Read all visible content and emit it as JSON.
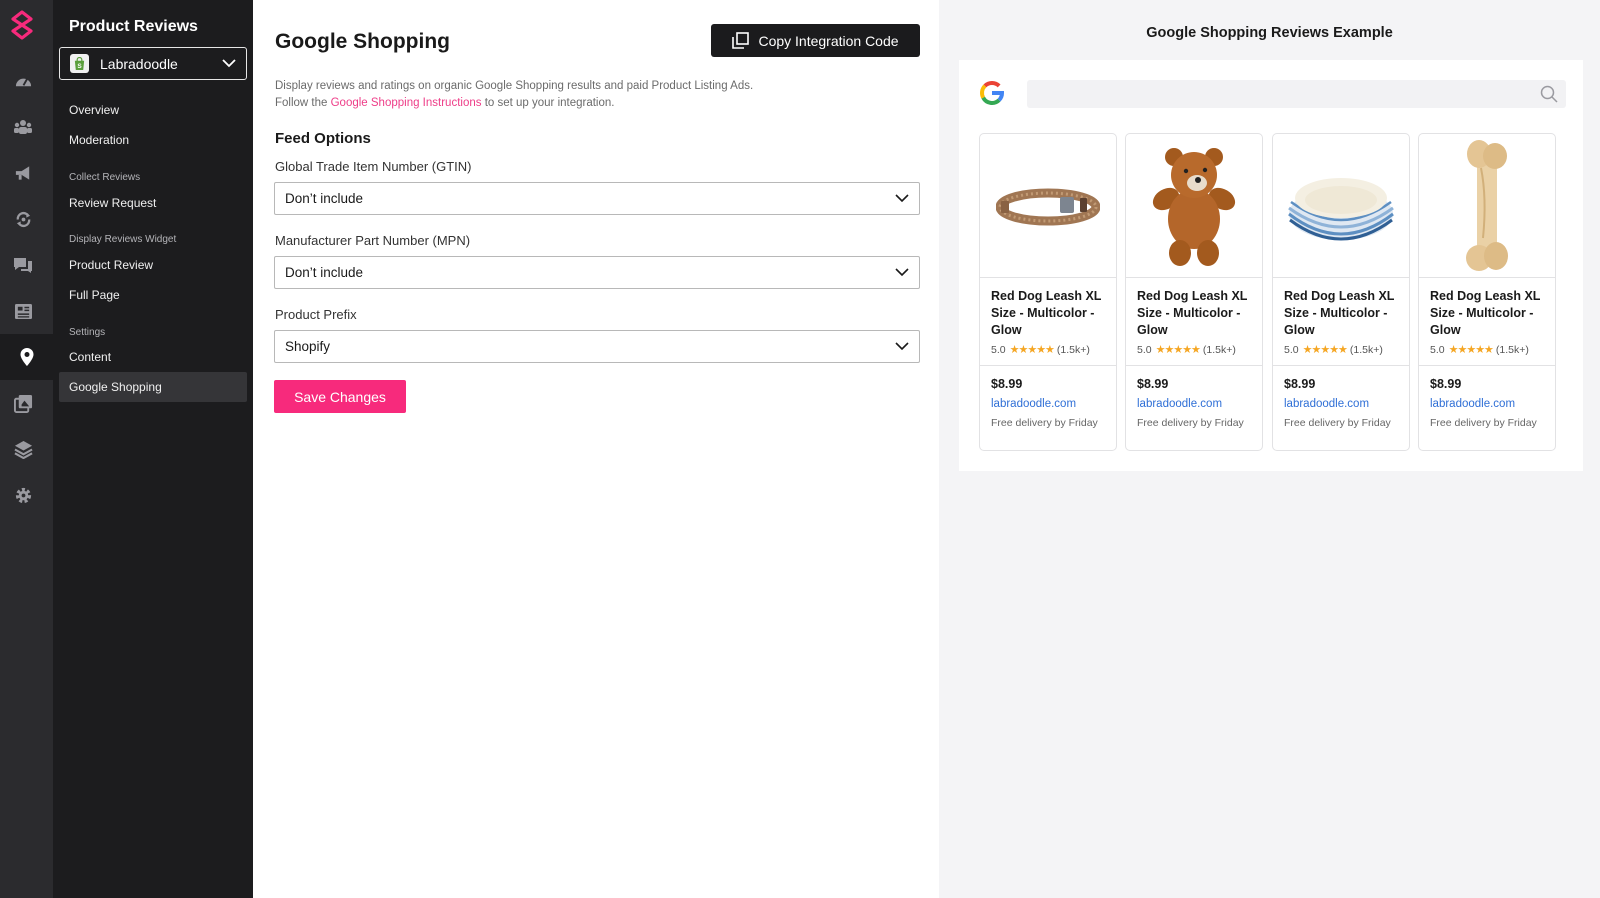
{
  "rail": {
    "icons": [
      "dashboard-icon",
      "customers-icon",
      "megaphone-icon",
      "automation-icon",
      "chat-reviews-icon",
      "newsletter-icon",
      "location-pin-icon",
      "gallery-icon",
      "integrations-icon",
      "settings-icon"
    ],
    "active": "location-pin-icon"
  },
  "sidebar": {
    "title": "Product Reviews",
    "store": "Labradoodle",
    "items": {
      "overview": "Overview",
      "moderation": "Moderation",
      "collect_group": "Collect Reviews",
      "review_request": "Review Request",
      "display_group": "Display Reviews Widget",
      "product_review": "Product Review",
      "full_page": "Full Page",
      "settings_group": "Settings",
      "content": "Content",
      "google_shopping": "Google Shopping"
    }
  },
  "main": {
    "title": "Google Shopping",
    "copy_button": "Copy Integration Code",
    "description_line1": "Display reviews and ratings on organic Google Shopping results and paid Product Listing Ads.",
    "description_prefix": "Follow the ",
    "description_link": "Google Shopping Instructions",
    "description_suffix": " to set up your integration.",
    "feed_options_title": "Feed Options",
    "gtin_label": "Global Trade Item Number (GTIN)",
    "gtin_value": "Don’t include",
    "mpn_label": "Manufacturer Part Number (MPN)",
    "mpn_value": "Don’t include",
    "prefix_label": "Product Prefix",
    "prefix_value": "Shopify",
    "save_button": "Save Changes"
  },
  "preview": {
    "title": "Google Shopping Reviews Example",
    "products": [
      {
        "name": "Red Dog Leash XL Size - Multicolor - Glow",
        "rating": "5.0",
        "stars": "★★★★★",
        "count": "(1.5k+)",
        "price": "$8.99",
        "domain": "labradoodle.com",
        "delivery": "Free delivery by Friday"
      },
      {
        "name": "Red Dog Leash XL Size - Multicolor - Glow",
        "rating": "5.0",
        "stars": "★★★★★",
        "count": "(1.5k+)",
        "price": "$8.99",
        "domain": "labradoodle.com",
        "delivery": "Free delivery by Friday"
      },
      {
        "name": "Red Dog Leash XL Size - Multicolor - Glow",
        "rating": "5.0",
        "stars": "★★★★★",
        "count": "(1.5k+)",
        "price": "$8.99",
        "domain": "labradoodle.com",
        "delivery": "Free delivery by Friday"
      },
      {
        "name": "Red Dog Leash XL Size - Multicolor - Glow",
        "rating": "5.0",
        "stars": "★★★★★",
        "count": "(1.5k+)",
        "price": "$8.99",
        "domain": "labradoodle.com",
        "delivery": "Free delivery by Friday"
      }
    ]
  },
  "colors": {
    "accent": "#f72a7c",
    "link": "#ee3d88",
    "sidebar_bg": "#1c1c1e",
    "rail_bg": "#2b2b2e",
    "star": "#f5a623",
    "domain_link": "#2f6fd6"
  }
}
